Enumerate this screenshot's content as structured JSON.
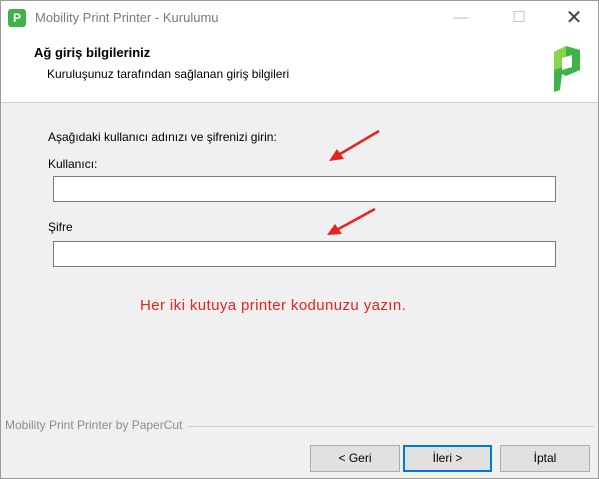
{
  "window": {
    "title": "Mobility Print Printer - Kurulumu",
    "app_icon_letter": "P",
    "controls": {
      "minimize": "—",
      "maximize": "☐",
      "close": "✕"
    }
  },
  "header": {
    "title": "Ağ giriş bilgileriniz",
    "subtitle": "Kuruluşunuz tarafından sağlanan giriş bilgileri",
    "logo": "papercut-logo-icon"
  },
  "form": {
    "instruction": "Aşağıdaki kullanıcı adınızı ve şifrenizi girin:",
    "username_label": "Kullanıcı:",
    "username_value": "",
    "password_label": "Şifre",
    "password_value": "",
    "note": "Her iki kutuya printer kodunuzu yazın."
  },
  "footer": {
    "brand": "Mobility Print Printer by PaperCut"
  },
  "buttons": {
    "back": "< Geri",
    "next": "İleri >",
    "cancel": "İptal"
  },
  "colors": {
    "accent_green": "#3db34a",
    "annotation_red": "#e8231f",
    "focus_blue": "#0078d7"
  }
}
